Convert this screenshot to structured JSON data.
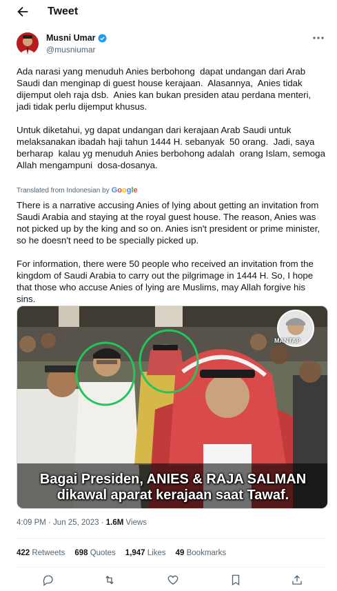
{
  "header": {
    "title": "Tweet"
  },
  "author": {
    "name": "Musni Umar",
    "handle": "@musniumar",
    "verified": true
  },
  "tweet": {
    "original_text": "Ada narasi yang menuduh Anies berbohong  dapat undangan dari Arab Saudi dan menginap di guest house kerajaan.  Alasannya,  Anies tidak dijemput oleh raja dsb.  Anies kan bukan presiden atau perdana menteri, jadi tidak perlu dijemput khusus.\n\nUntuk diketahui, yg dapat undangan dari kerajaan Arab Saudi untuk melaksanakan ibadah haji tahun 1444 H. sebanyak  50 orang.  Jadi, saya berharap  kalau yg menuduh Anies berbohong adalah  orang Islam, semoga Allah mengampuni  dosa-dosanya.",
    "translated_label": "Translated from Indonesian by",
    "translated_text": "There is a narrative accusing Anies of lying about getting an invitation from Saudi Arabia and staying at the royal guest house. The reason, Anies was not picked up by the king and so on. Anies isn't president or prime minister, so he doesn't need to be specially picked up.\n\nFor information, there were 50 people who received an invitation from the kingdom of Saudi Arabia to carry out the pilgrimage in 1444 H. So, I hope that those who accuse Anies of lying are Muslims, may Allah forgive his sins."
  },
  "media": {
    "caption_line1": "Bagai Presiden, ANIES & RAJA SALMAN",
    "caption_line2": "dikawal aparat kerajaan saat Tawaf.",
    "badge": "MANTAP"
  },
  "meta": {
    "time": "4:09 PM · Jun 25, 2023 · ",
    "views_count": "1.6M",
    "views_label": " Views"
  },
  "stats": {
    "retweets_count": "422",
    "retweets_label": " Retweets",
    "quotes_count": "698",
    "quotes_label": " Quotes",
    "likes_count": "1,947",
    "likes_label": " Likes",
    "bookmarks_count": "49",
    "bookmarks_label": " Bookmarks"
  },
  "colors": {
    "accent": "#1d9bf0",
    "secondary_text": "#536471",
    "circle_highlight": "#22c55e"
  },
  "icons": [
    "back-arrow-icon",
    "verified-badge-icon",
    "more-icon",
    "reply-icon",
    "retweet-icon",
    "like-icon",
    "bookmark-icon",
    "share-icon"
  ]
}
